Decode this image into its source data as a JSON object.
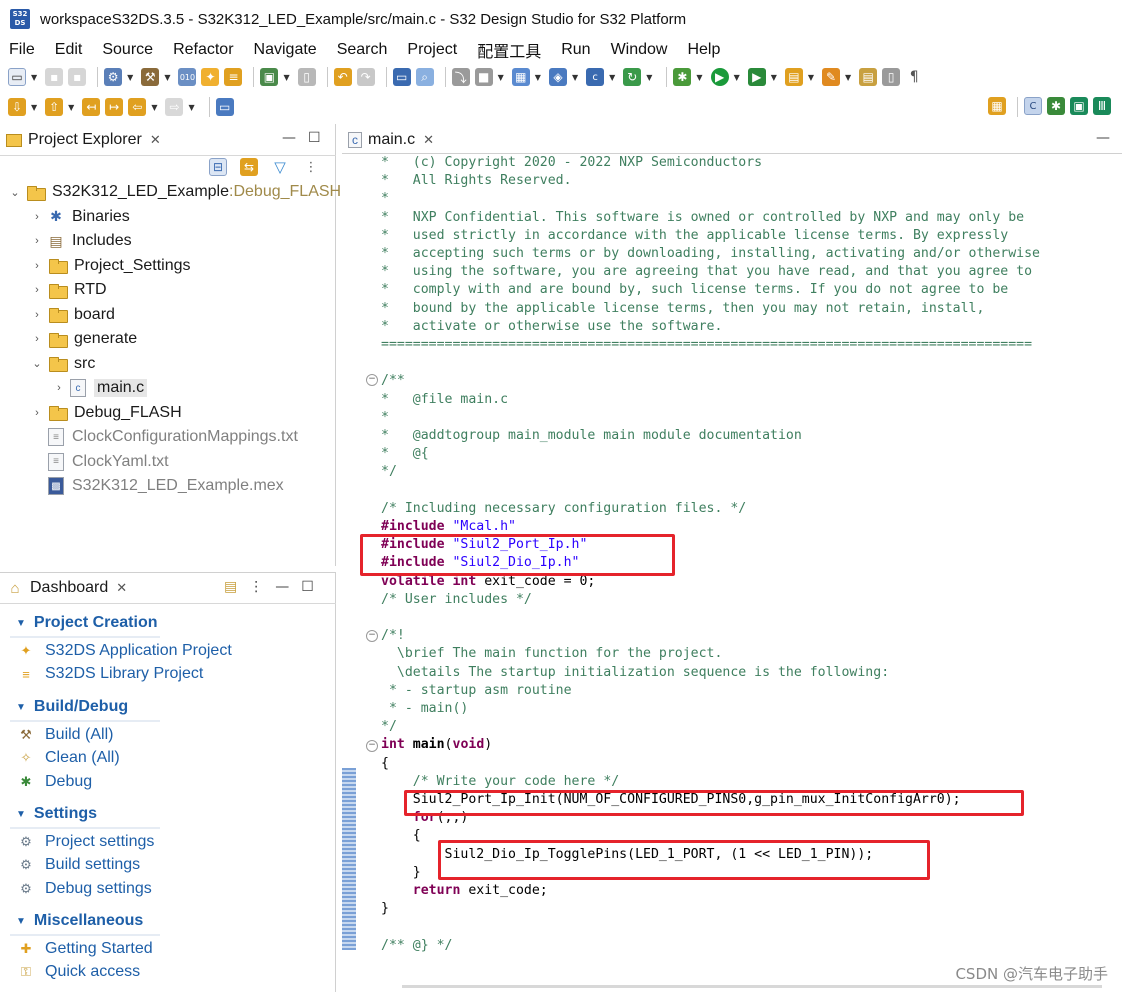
{
  "window": {
    "title": "workspaceS32DS.3.5 - S32K312_LED_Example/src/main.c - S32 Design Studio for S32 Platform",
    "app_icon": "S32 DS"
  },
  "menu": [
    "File",
    "Edit",
    "Source",
    "Refactor",
    "Navigate",
    "Search",
    "Project",
    "配置工具",
    "Run",
    "Window",
    "Help"
  ],
  "project_explorer": {
    "title": "Project Explorer",
    "tree": [
      {
        "label": "S32K312_LED_Example",
        "decoration": " Debug_FLASH",
        "icon": "project-folder-icon",
        "twisty": "open",
        "indent": 0
      },
      {
        "label": "Binaries",
        "icon": "binaries-icon",
        "twisty": "closed",
        "indent": 1
      },
      {
        "label": "Includes",
        "icon": "includes-icon",
        "twisty": "closed",
        "indent": 1
      },
      {
        "label": "Project_Settings",
        "icon": "folder-icon",
        "twisty": "closed",
        "indent": 1
      },
      {
        "label": "RTD",
        "icon": "folder-icon",
        "twisty": "closed",
        "indent": 1
      },
      {
        "label": "board",
        "icon": "folder-icon",
        "twisty": "closed",
        "indent": 1
      },
      {
        "label": "generate",
        "icon": "folder-icon",
        "twisty": "closed",
        "indent": 1
      },
      {
        "label": "src",
        "icon": "folder-icon",
        "twisty": "open",
        "indent": 1
      },
      {
        "label": "main.c",
        "icon": "c-file-icon",
        "twisty": "closed",
        "indent": 2,
        "selected": true
      },
      {
        "label": "Debug_FLASH",
        "icon": "folder-icon",
        "twisty": "closed",
        "indent": 1
      },
      {
        "label": "ClockConfigurationMappings.txt",
        "icon": "text-file-icon",
        "twisty": "none",
        "indent": 1,
        "dim": true
      },
      {
        "label": "ClockYaml.txt",
        "icon": "text-file-icon",
        "twisty": "none",
        "indent": 1,
        "dim": true
      },
      {
        "label": "S32K312_LED_Example.mex",
        "icon": "mex-file-icon",
        "twisty": "none",
        "indent": 1,
        "dim": true
      }
    ]
  },
  "dashboard": {
    "title": "Dashboard",
    "sections": [
      {
        "title": "Project Creation",
        "links": [
          {
            "label": "S32DS Application Project",
            "icon": "new-app-project-icon"
          },
          {
            "label": "S32DS Library Project",
            "icon": "new-lib-project-icon"
          }
        ]
      },
      {
        "title": "Build/Debug",
        "links": [
          {
            "label": "Build  (All)",
            "icon": "hammer-icon"
          },
          {
            "label": "Clean  (All)",
            "icon": "broom-icon"
          },
          {
            "label": "Debug",
            "icon": "bug-icon"
          }
        ]
      },
      {
        "title": "Settings",
        "links": [
          {
            "label": "Project settings",
            "icon": "settings-gear-icon"
          },
          {
            "label": "Build settings",
            "icon": "settings-gear-icon"
          },
          {
            "label": "Debug settings",
            "icon": "settings-gear-icon"
          }
        ]
      },
      {
        "title": "Miscellaneous",
        "links": [
          {
            "label": "Getting Started",
            "icon": "getting-started-icon"
          },
          {
            "label": "Quick access",
            "icon": "key-icon"
          }
        ]
      }
    ]
  },
  "editor": {
    "tab_label": "main.c",
    "lines": [
      [
        [
          "c",
          "*   (c) Copyright 2020 - 2022 NXP Semiconductors"
        ]
      ],
      [
        [
          "c",
          "*   All Rights Reserved."
        ]
      ],
      [
        [
          "c",
          "*"
        ]
      ],
      [
        [
          "c",
          "*   NXP Confidential. This software is owned or controlled by NXP and may only be"
        ]
      ],
      [
        [
          "c",
          "*   used strictly in accordance with the applicable license terms. By expressly"
        ]
      ],
      [
        [
          "c",
          "*   accepting such terms or by downloading, installing, activating and/or otherwise"
        ]
      ],
      [
        [
          "c",
          "*   using the software, you are agreeing that you have read, and that you agree to"
        ]
      ],
      [
        [
          "c",
          "*   comply with and are bound by, such license terms. If you do not agree to be"
        ]
      ],
      [
        [
          "c",
          "*   bound by the applicable license terms, then you may not retain, install,"
        ]
      ],
      [
        [
          "c",
          "*   activate or otherwise use the software."
        ]
      ],
      [
        [
          "c",
          "=================================================================================="
        ]
      ],
      [],
      [
        [
          "c",
          "/**"
        ]
      ],
      [
        [
          "c",
          "*   @file main.c"
        ]
      ],
      [
        [
          "c",
          "*"
        ]
      ],
      [
        [
          "c",
          "*   @addtogroup main_module main module documentation"
        ]
      ],
      [
        [
          "c",
          "*   @{"
        ]
      ],
      [
        [
          "c",
          "*/"
        ]
      ],
      [],
      [
        [
          "c",
          "/* Including necessary configuration files. */"
        ]
      ],
      [
        [
          "p",
          "#include "
        ],
        [
          "s",
          "\"Mcal.h\""
        ]
      ],
      [
        [
          "p",
          "#include "
        ],
        [
          "s",
          "\"Siul2_Port_Ip.h\""
        ]
      ],
      [
        [
          "p",
          "#include "
        ],
        [
          "s",
          "\"Siul2_Dio_Ip.h\""
        ]
      ],
      [
        [
          "k",
          "volatile int"
        ],
        [
          "n",
          " exit_code = 0;"
        ]
      ],
      [
        [
          "c",
          "/* User includes */"
        ]
      ],
      [],
      [
        [
          "c",
          "/*!"
        ]
      ],
      [
        [
          "c",
          "  \\brief The main function for the project."
        ]
      ],
      [
        [
          "c",
          "  \\details The startup initialization sequence is the following:"
        ]
      ],
      [
        [
          "c",
          " * - startup asm routine"
        ]
      ],
      [
        [
          "c",
          " * - main()"
        ]
      ],
      [
        [
          "c",
          "*/"
        ]
      ],
      [
        [
          "k",
          "int"
        ],
        [
          "n",
          " "
        ],
        [
          "b",
          "main"
        ],
        [
          "n",
          "("
        ],
        [
          "k",
          "void"
        ],
        [
          "n",
          ")"
        ]
      ],
      [
        [
          "n",
          "{"
        ]
      ],
      [
        [
          "n",
          "    "
        ],
        [
          "c",
          "/* Write your code here */"
        ]
      ],
      [
        [
          "n",
          "    Siul2_Port_Ip_Init(NUM_OF_CONFIGURED_PINS0,g_pin_mux_InitConfigArr0);"
        ]
      ],
      [
        [
          "n",
          "    "
        ],
        [
          "k",
          "for"
        ],
        [
          "n",
          "(;;)"
        ]
      ],
      [
        [
          "n",
          "    {"
        ]
      ],
      [
        [
          "n",
          "        Siul2_Dio_Ip_TogglePins(LED_1_PORT, (1 << LED_1_PIN));"
        ]
      ],
      [
        [
          "n",
          "    }"
        ]
      ],
      [
        [
          "n",
          "    "
        ],
        [
          "k",
          "return"
        ],
        [
          "n",
          " exit_code;"
        ]
      ],
      [
        [
          "n",
          "}"
        ]
      ],
      [],
      [
        [
          "c",
          "/** @} */"
        ]
      ]
    ]
  },
  "watermark": "CSDN @汽车电子助手",
  "colors": {
    "highlight_box": "#e5232b",
    "link_blue": "#1e5fa8",
    "comment_green": "#3f7f5f",
    "keyword_purple": "#7f0055",
    "string_blue": "#2a00ff"
  }
}
